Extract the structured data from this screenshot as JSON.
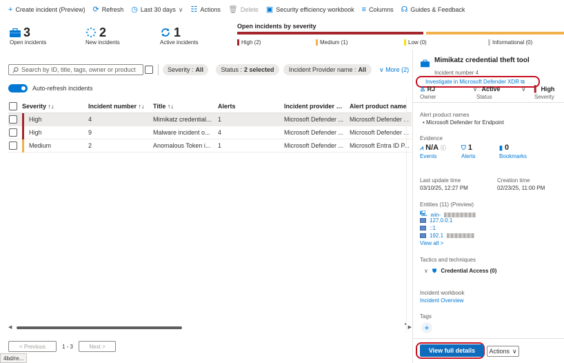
{
  "toolbar": {
    "create": "Create incident (Preview)",
    "refresh": "Refresh",
    "time_range": "Last 30 days",
    "actions": "Actions",
    "delete": "Delete",
    "workbook": "Security efficiency workbook",
    "columns": "Columns",
    "guides": "Guides & Feedback"
  },
  "stats": {
    "open": {
      "value": "3",
      "label": "Open incidents"
    },
    "new": {
      "value": "2",
      "label": "New incidents"
    },
    "active": {
      "value": "1",
      "label": "Active incidents"
    }
  },
  "severity_summary": {
    "title": "Open incidents by severity",
    "high": "High (2)",
    "medium": "Medium (1)",
    "low": "Low (0)",
    "informational": "Informational (0)",
    "colors": {
      "high": "#a4262c",
      "medium": "#f2b04c",
      "low": "#fce100",
      "informational": "#c8c6c4"
    }
  },
  "filters": {
    "search_placeholder": "Search by ID, title, tags, owner or product",
    "severity_label": "Severity :",
    "severity_value": "All",
    "status_label": "Status :",
    "status_value": "2 selected",
    "provider_label": "Incident Provider name :",
    "provider_value": "All",
    "more": "More (2)",
    "auto_refresh": "Auto-refresh incidents"
  },
  "table": {
    "columns": [
      "Severity ↑↓",
      "Incident number ↑↓",
      "Title ↑↓",
      "Alerts",
      "Incident provider na...",
      "Alert product name"
    ],
    "rows": [
      {
        "severity": "High",
        "number": "4",
        "title": "Mimikatz credential...",
        "alerts": "1",
        "provider": "Microsoft Defender ...",
        "product": "Microsoft Defender ...",
        "color": "#a4262c"
      },
      {
        "severity": "High",
        "number": "9",
        "title": "Malware incident o...",
        "alerts": "4",
        "provider": "Microsoft Defender ...",
        "product": "Microsoft Defender ...",
        "color": "#a4262c"
      },
      {
        "severity": "Medium",
        "number": "2",
        "title": "Anomalous Token i...",
        "alerts": "1",
        "provider": "Microsoft Defender ...",
        "product": "Microsoft Entra ID P...",
        "color": "#f2b04c"
      }
    ]
  },
  "pager": {
    "previous": "< Previous",
    "range": "1 - 3",
    "next": "Next >"
  },
  "status_url": "4bd/re...",
  "panel": {
    "title": "Mimikatz credential theft tool",
    "subtitle": "Incident number 4",
    "investigate": "Investigate in Microsoft Defender XDR",
    "owner_value": "RJ",
    "owner_label": "Owner",
    "status_value": "Active",
    "status_label": "Status",
    "severity_value": "High",
    "severity_label": "Severity",
    "alert_products_title": "Alert product names",
    "alert_product": "Microsoft Defender for Endpoint",
    "evidence_title": "Evidence",
    "events_value": "N/A",
    "events_label": "Events",
    "alerts_value": "1",
    "alerts_label": "Alerts",
    "bookmarks_value": "0",
    "bookmarks_label": "Bookmarks",
    "last_update_label": "Last update time",
    "last_update_value": "03/10/25, 12:27 PM",
    "creation_label": "Creation time",
    "creation_value": "02/23/25, 11:00 PM",
    "entities_title": "Entities (11) (Preview)",
    "entities": [
      "win-",
      "127.0.0.1",
      "::1",
      "192.1"
    ],
    "view_all": "View all >",
    "tactics_title": "Tactics and techniques",
    "tactic": "Credential Access (0)",
    "workbook_title": "Incident workbook",
    "workbook_link": "Incident Overview",
    "tags_title": "Tags",
    "view_full": "View full details",
    "actions": "Actions"
  }
}
